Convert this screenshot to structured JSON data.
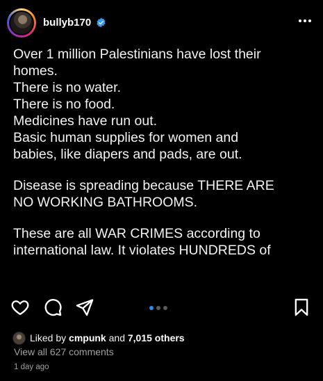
{
  "header": {
    "username": "bullyb170",
    "more_icon": "more-horizontal-icon",
    "verified_icon": "verified-badge-icon",
    "verified_color": "#3897f0"
  },
  "post": {
    "lines_p1": [
      "Over 1 million Palestinians have lost their",
      "homes.",
      "There is no water.",
      "There is no food.",
      "Medicines have run out.",
      "Basic human supplies for women and",
      "babies, like diapers and pads, are out."
    ],
    "lines_p2": [
      "Disease is spreading because THERE ARE",
      "NO WORKING BATHROOMS."
    ],
    "lines_p3": [
      "These are all WAR CRIMES according to",
      "international law. It violates HUNDREDS of"
    ]
  },
  "actions": {
    "like_icon": "heart-icon",
    "comment_icon": "comment-icon",
    "share_icon": "send-icon",
    "save_icon": "bookmark-icon",
    "carousel_count": 3,
    "carousel_active_index": 0,
    "carousel_active_color": "#2e8be6"
  },
  "likes": {
    "prefix": "Liked by ",
    "user": "cmpunk",
    "middle": " and ",
    "others": "7,015 others"
  },
  "comments_link": "View all 627 comments",
  "timestamp": "1 day ago"
}
